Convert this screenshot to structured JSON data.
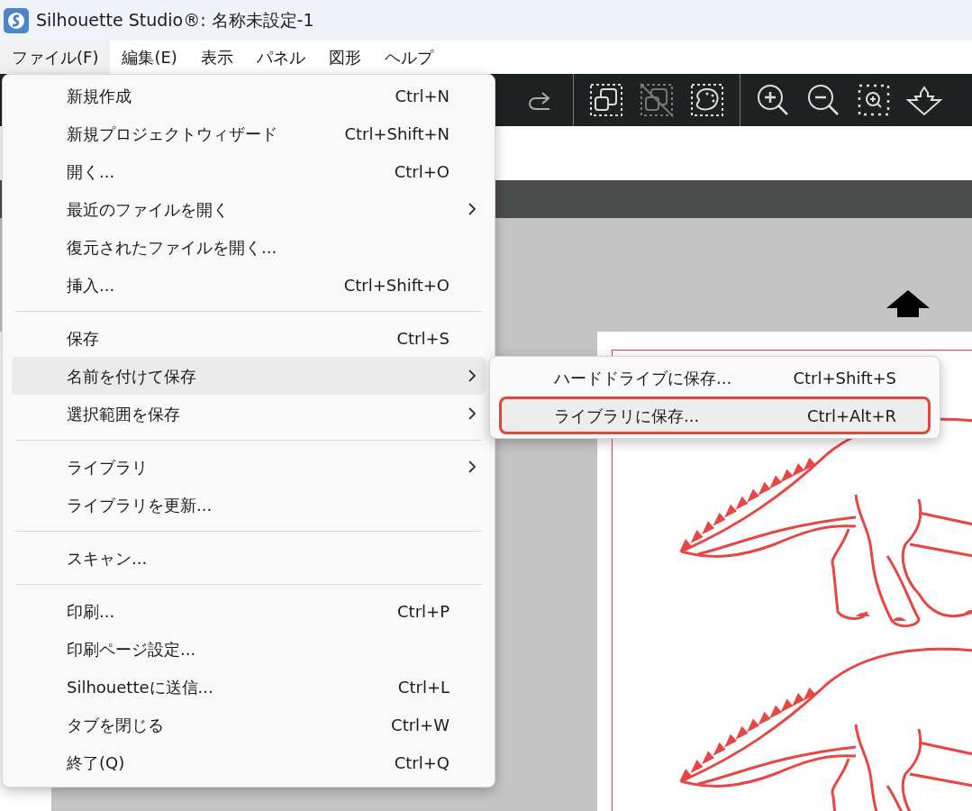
{
  "window": {
    "title": "Silhouette Studio®: 名称未設定-1"
  },
  "menu_bar": [
    {
      "label": "ファイル(F)",
      "selected": true
    },
    {
      "label": "編集(E)",
      "selected": false
    },
    {
      "label": "表示",
      "selected": false
    },
    {
      "label": "パネル",
      "selected": false
    },
    {
      "label": "図形",
      "selected": false
    },
    {
      "label": "ヘルプ",
      "selected": false
    }
  ],
  "file_menu": {
    "items": [
      {
        "kind": "item",
        "label": "新規作成",
        "shortcut": "Ctrl+N",
        "submenu": false,
        "selected": false
      },
      {
        "kind": "item",
        "label": "新規プロジェクトウィザード",
        "shortcut": "Ctrl+Shift+N",
        "submenu": false,
        "selected": false
      },
      {
        "kind": "item",
        "label": "開く...",
        "shortcut": "Ctrl+O",
        "submenu": false,
        "selected": false
      },
      {
        "kind": "item",
        "label": "最近のファイルを開く",
        "submenu": true,
        "selected": false
      },
      {
        "kind": "item",
        "label": "復元されたファイルを開く...",
        "submenu": false,
        "selected": false
      },
      {
        "kind": "item",
        "label": "挿入...",
        "shortcut": "Ctrl+Shift+O",
        "submenu": false,
        "selected": false
      },
      {
        "kind": "separator"
      },
      {
        "kind": "item",
        "label": "保存",
        "shortcut": "Ctrl+S",
        "submenu": false,
        "selected": false
      },
      {
        "kind": "item",
        "label": "名前を付けて保存",
        "submenu": true,
        "selected": true
      },
      {
        "kind": "item",
        "label": "選択範囲を保存",
        "submenu": true,
        "selected": false
      },
      {
        "kind": "separator"
      },
      {
        "kind": "item",
        "label": "ライブラリ",
        "submenu": true,
        "selected": false
      },
      {
        "kind": "item",
        "label": "ライブラリを更新...",
        "submenu": false,
        "selected": false
      },
      {
        "kind": "separator"
      },
      {
        "kind": "item",
        "label": "スキャン...",
        "submenu": false,
        "selected": false
      },
      {
        "kind": "separator"
      },
      {
        "kind": "item",
        "label": "印刷...",
        "shortcut": "Ctrl+P",
        "submenu": false,
        "selected": false
      },
      {
        "kind": "item",
        "label": "印刷ページ設定...",
        "submenu": false,
        "selected": false
      },
      {
        "kind": "item",
        "label": "Silhouetteに送信...",
        "shortcut": "Ctrl+L",
        "submenu": false,
        "selected": false
      },
      {
        "kind": "item",
        "label": "タブを閉じる",
        "shortcut": "Ctrl+W",
        "submenu": false,
        "selected": false
      },
      {
        "kind": "item",
        "label": "終了(Q)",
        "shortcut": "Ctrl+Q",
        "submenu": false,
        "selected": false
      }
    ]
  },
  "save_as_submenu": {
    "items": [
      {
        "label": "ハードドライブに保存...",
        "shortcut": "Ctrl+Shift+S",
        "selected": false,
        "outlined": false
      },
      {
        "label": "ライブラリに保存...",
        "shortcut": "Ctrl+Alt+R",
        "selected": true,
        "outlined": true
      }
    ]
  }
}
